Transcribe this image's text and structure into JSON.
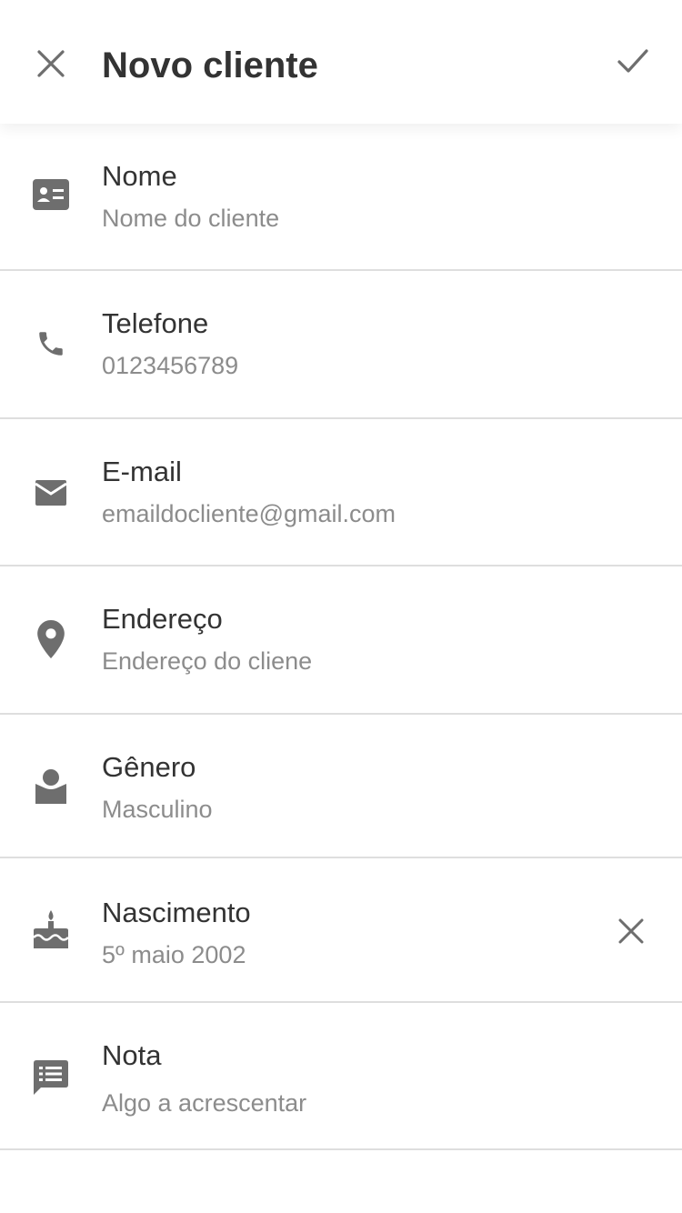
{
  "header": {
    "title": "Novo cliente",
    "close_icon": "close-icon",
    "confirm_icon": "check-icon"
  },
  "fields": [
    {
      "key": "nome",
      "icon": "id-card-icon",
      "label": "Nome",
      "value": "Nome do cliente"
    },
    {
      "key": "telefone",
      "icon": "phone-icon",
      "label": "Telefone",
      "value": "0123456789"
    },
    {
      "key": "email",
      "icon": "mail-icon",
      "label": "E-mail",
      "value": "emaildocliente@gmail.com"
    },
    {
      "key": "endereco",
      "icon": "location-pin-icon",
      "label": "Endereço",
      "value": "Endereço do cliene"
    },
    {
      "key": "genero",
      "icon": "person-icon",
      "label": "Gênero",
      "value": "Masculino"
    },
    {
      "key": "nascimento",
      "icon": "cake-icon",
      "label": "Nascimento",
      "value": "5º maio 2002",
      "clear_icon": "close-icon"
    },
    {
      "key": "nota",
      "icon": "note-icon",
      "label": "Nota",
      "value": "Algo a acrescentar"
    }
  ],
  "colors": {
    "text": "#333333",
    "secondary_text": "#8c8c8c",
    "icon": "#6e6e6e",
    "divider": "#dedede"
  }
}
